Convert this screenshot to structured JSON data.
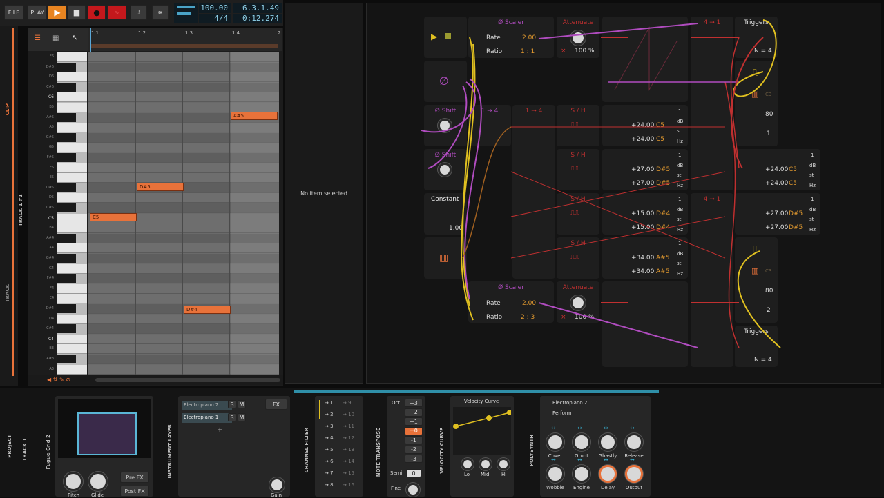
{
  "transport": {
    "file_label": "FILE",
    "play_label": "PLAY",
    "tempo": "100.00",
    "signature": "4/4",
    "position": "6.3.1.49",
    "time": "0:12.274"
  },
  "editor": {
    "ruler": [
      "1.1",
      "1.2",
      "1.3",
      "1.4",
      "2"
    ],
    "side_labels": {
      "clip": "CLIP",
      "track": "TRACK 1 #1",
      "trackb": "TRACK"
    },
    "keys": [
      "E6",
      "D#6",
      "D6",
      "C#6",
      "C6",
      "B5",
      "A#5",
      "A5",
      "G#5",
      "G5",
      "F#5",
      "F5",
      "E5",
      "D#5",
      "D5",
      "C#5",
      "C5",
      "B4",
      "A#4",
      "A4",
      "G#4",
      "G4",
      "F#4",
      "F4",
      "E4",
      "D#4",
      "D4",
      "C#4",
      "C4",
      "B3",
      "A#3",
      "A3"
    ],
    "notes": [
      {
        "label": "A#5"
      },
      {
        "label": "D#5"
      },
      {
        "label": "C5"
      },
      {
        "label": "D#4"
      }
    ]
  },
  "inspector": {
    "empty_text": "No item selected"
  },
  "grid": {
    "scaler_title": "Ø Scaler",
    "rate_label": "Rate",
    "rate_value": "2.00",
    "ratio_label": "Ratio",
    "ratio_value_top": "1 : 1",
    "ratio_value_bottom": "2 : 3",
    "attenuate": "Attenuate",
    "attenuate_pct": "100 %",
    "x_mark": "×",
    "triggers": "Triggers",
    "n_label": "N = 4",
    "phase_shift": "Ø Shift",
    "constant": "Constant",
    "constant_value": "1.00",
    "sh": "S / H",
    "one_to_four": "1 → 4",
    "four_to_one": "4 → 1",
    "one": "1",
    "db": "dB",
    "st": "st",
    "hz": "Hz",
    "pitch_rows": [
      {
        "value": "+24.00",
        "note": "C5"
      },
      {
        "value": "+27.00",
        "note": "D#5"
      },
      {
        "value": "+15.00",
        "note": "D#4"
      },
      {
        "value": "+34.00",
        "note": "A#5"
      }
    ],
    "side_rows": [
      {
        "value": "+24.00",
        "note": "C5"
      },
      {
        "value": "+27.00",
        "note": "D#5"
      }
    ],
    "note_c3": "C3",
    "num80": "80",
    "num1": "1",
    "num2": "2"
  },
  "devices": {
    "project": "PROJECT",
    "track": "TRACK 1",
    "fugue": "Fugue Grid 2",
    "instrument_layer": "INSTRUMENT LAYER",
    "layers": [
      {
        "name": "Electropiano 2"
      },
      {
        "name": "Electropiano 1"
      }
    ],
    "s": "S",
    "m": "M",
    "fx": "FX",
    "pitch": "Pitch",
    "glide": "Glide",
    "pre_fx": "Pre FX",
    "post_fx": "Post FX",
    "gain": "Gain",
    "channel_filter": "CHANNEL FILTER",
    "ch_left": [
      "1",
      "2",
      "3",
      "4",
      "5",
      "6",
      "7",
      "8"
    ],
    "ch_right": [
      "9",
      "10",
      "11",
      "12",
      "13",
      "14",
      "15",
      "16"
    ],
    "note_transpose": "NOTE TRANSPOSE",
    "oct": "Oct",
    "oct_values": [
      "+3",
      "+2",
      "+1",
      "±0",
      "-1",
      "-2",
      "-3"
    ],
    "semi": "Semi",
    "semi_value": "0",
    "fine": "Fine",
    "velocity_curve": "VELOCITY CURVE",
    "vc_title": "Velocity Curve",
    "lo": "Lo",
    "mid": "Mid",
    "hi": "Hi",
    "polysynth": "POLYSYNTH",
    "preset": "Electropiano 2",
    "perform": "Perform",
    "macros": [
      "Cover",
      "Grunt",
      "Ghastly",
      "Release",
      "Wobble",
      "Engine",
      "Delay",
      "Output"
    ]
  }
}
